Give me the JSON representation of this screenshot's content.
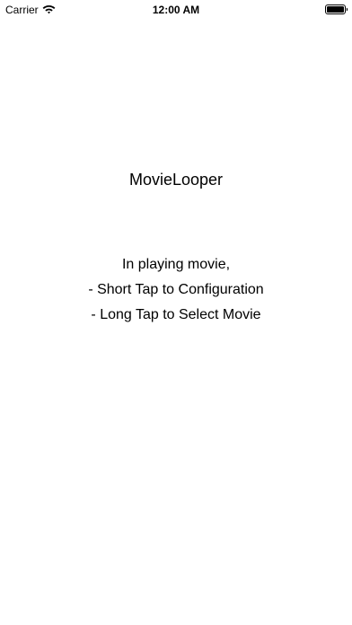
{
  "status_bar": {
    "carrier": "Carrier",
    "time": "12:00 AM",
    "wifi_icon": "wifi-icon",
    "battery_icon": "battery-icon"
  },
  "main": {
    "title": "MovieLooper",
    "instructions": [
      "In playing movie,",
      "- Short Tap to Configuration",
      "- Long Tap to Select Movie"
    ]
  }
}
